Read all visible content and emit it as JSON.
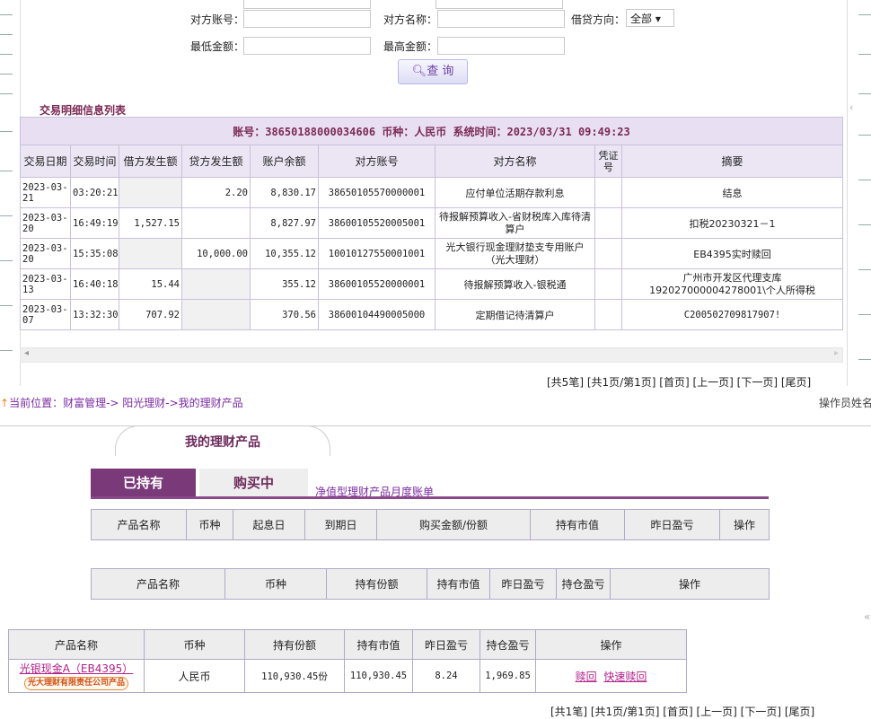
{
  "filters": {
    "opp_account_label": "对方账号：",
    "opp_name_label": "对方名称：",
    "dc_direction_label": "借贷方向：",
    "dc_direction_value": "全部",
    "min_amount_label": "最低金额：",
    "max_amount_label": "最高金额：",
    "query_button": "查 询"
  },
  "detail_list": {
    "title": "交易明细信息列表",
    "account_bar": "账号：38650188000034606   币种：人民币   系统时间：2023/03/31 09:49:23",
    "headers": [
      "交易日期",
      "交易时间",
      "借方发生额",
      "贷方发生额",
      "账户余额",
      "对方账号",
      "对方名称",
      "凭证号",
      "摘要"
    ],
    "rows": [
      {
        "date": "2023-03-21",
        "time": "03:20:21",
        "debit": "",
        "credit": "2.20",
        "balance": "8,830.17",
        "opp_acct": "38650105570000001",
        "opp_name": "应付单位活期存款利息",
        "voucher": "",
        "memo": "结息"
      },
      {
        "date": "2023-03-20",
        "time": "16:49:19",
        "debit": "1,527.15",
        "credit": "",
        "balance": "8,827.97",
        "opp_acct": "38600105520005001",
        "opp_name": "待报解预算收入-省财税库入库待清算户",
        "voucher": "",
        "memo": "扣税20230321－1"
      },
      {
        "date": "2023-03-20",
        "time": "15:35:08",
        "debit": "",
        "credit": "10,000.00",
        "balance": "10,355.12",
        "opp_acct": "10010127550001001",
        "opp_name": "光大银行现金理财垫支专用账户（光大理财）",
        "voucher": "",
        "memo": "EB4395实时赎回"
      },
      {
        "date": "2023-03-13",
        "time": "16:40:18",
        "debit": "15.44",
        "credit": "",
        "balance": "355.12",
        "opp_acct": "38600105520000001",
        "opp_name": "待报解预算收入-银税通",
        "voucher": "",
        "memo": "广州市开发区代理支库192027000004278001\\个人所得税"
      },
      {
        "date": "2023-03-07",
        "time": "13:32:30",
        "debit": "707.92",
        "credit": "",
        "balance": "370.56",
        "opp_acct": "38600104490005000",
        "opp_name": "定期借记待清算户",
        "voucher": "",
        "memo": "C200502709817907!"
      }
    ],
    "pager": "[共5笔] [共1页/第1页] [首页] [上一页] [下一页] [尾页]"
  },
  "location": {
    "prefix": "当前位置：",
    "path": "财富管理-> 阳光理财->我的理财产品",
    "operator": "操作员姓名"
  },
  "products": {
    "main_tab": "我的理财产品",
    "tab_held": "已持有",
    "tab_buying": "购买中",
    "monthly_bill_link": "净值型理财产品月度账单",
    "table1_headers": [
      "产品名称",
      "币种",
      "起息日",
      "到期日",
      "购买金额/份额",
      "持有市值",
      "昨日盈亏",
      "操作"
    ],
    "table2_headers": [
      "产品名称",
      "币种",
      "持有份额",
      "持有市值",
      "昨日盈亏",
      "持仓盈亏",
      "操作"
    ],
    "table3_headers": [
      "产品名称",
      "币种",
      "持有份额",
      "持有市值",
      "昨日盈亏",
      "持仓盈亏",
      "操作"
    ],
    "table3_row": {
      "name": "光银现金A（EB4395）",
      "issuer_badge": "光大理财有限责任公司产品",
      "currency": "人民币",
      "shares": "110,930.45份",
      "market_value": "110,930.45",
      "yesterday_pl": "8.24",
      "position_pl": "1,969.85",
      "redeem": "赎回",
      "fast_redeem": "快速赎回"
    },
    "pager": "[共1笔] [共1页/第1页] [首页] [上一页] [下一页] [尾页]"
  }
}
